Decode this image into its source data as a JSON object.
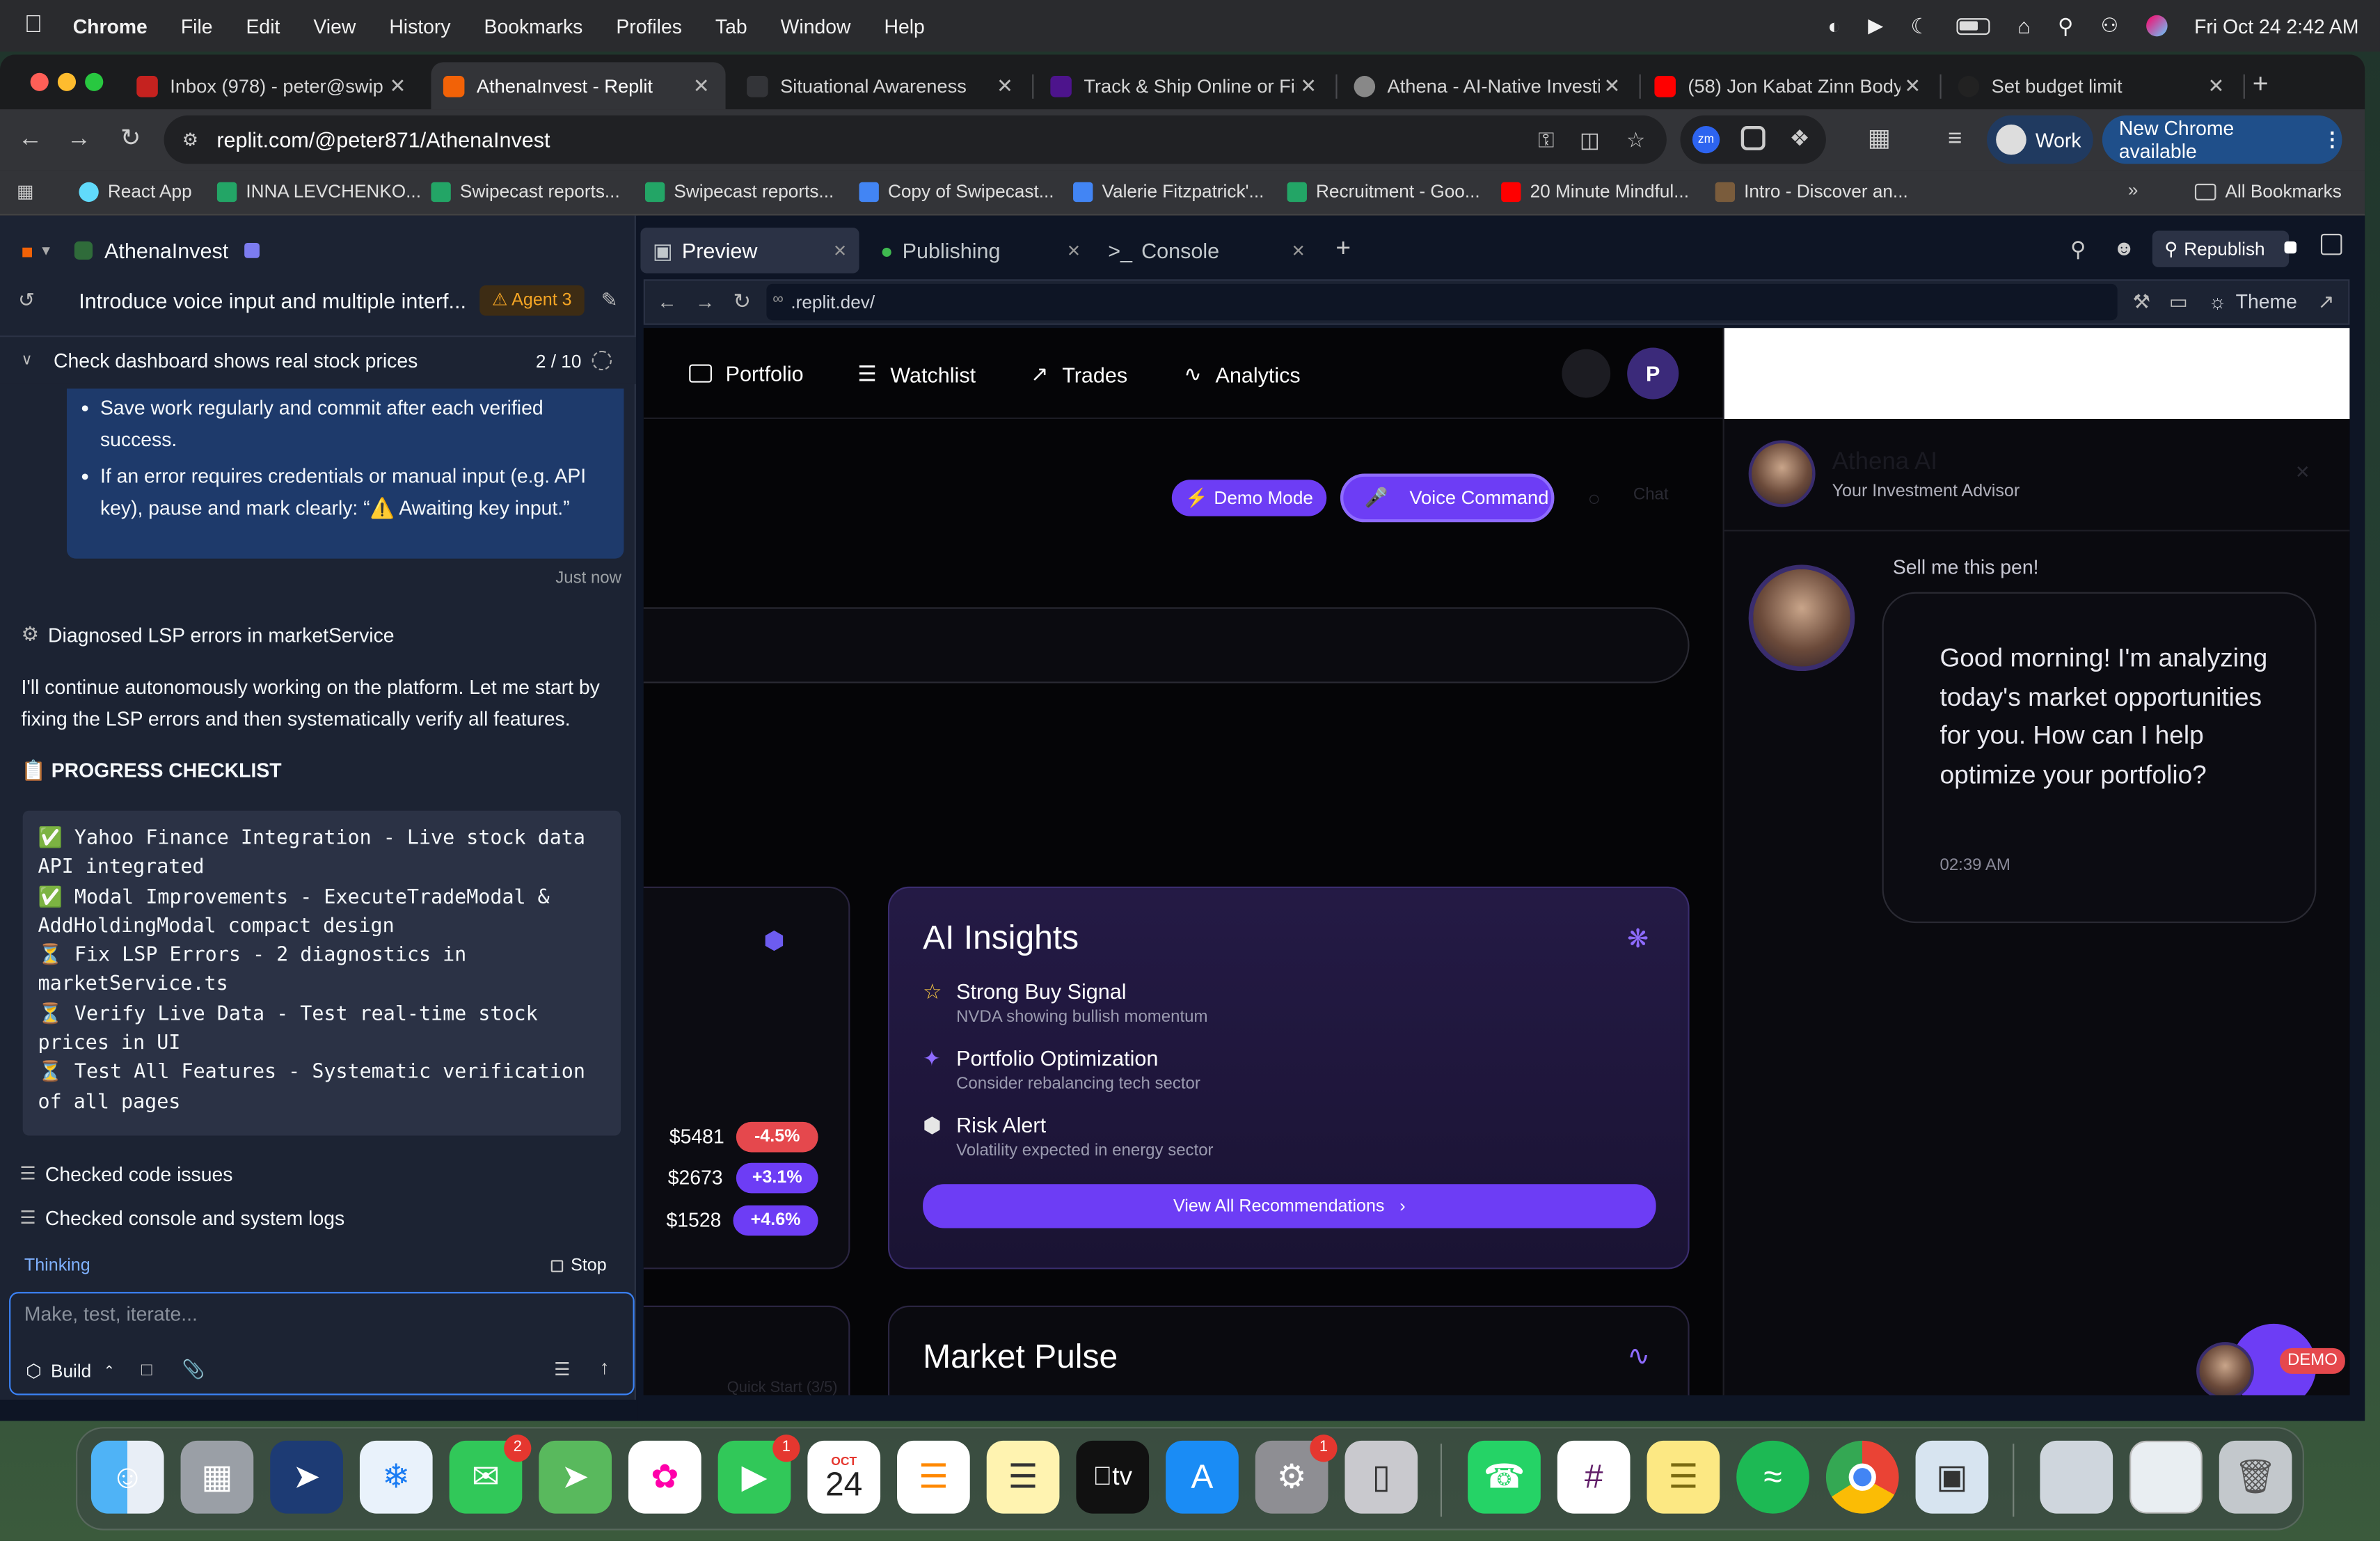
{
  "menubar": {
    "app": "Chrome",
    "items": [
      "File",
      "Edit",
      "View",
      "History",
      "Bookmarks",
      "Profiles",
      "Tab",
      "Window",
      "Help"
    ],
    "clock": "Fri Oct 24  2:42 AM"
  },
  "tabs": [
    {
      "title": "Inbox (978) - peter@swip",
      "color": "#c5221f"
    },
    {
      "title": "AthenaInvest - Replit",
      "color": "#f26207"
    },
    {
      "title": "Situational Awareness",
      "color": "#333438"
    },
    {
      "title": "Track & Ship Online or Fin",
      "color": "#4d148c"
    },
    {
      "title": "Athena - AI-Native Investi",
      "color": "#888888"
    },
    {
      "title": "(58) Jon Kabat Zinn Body",
      "color": "#ff0000"
    },
    {
      "title": "Set budget limit",
      "color": "#222222"
    }
  ],
  "toolbar": {
    "url": "replit.com/@peter871/AthenaInvest",
    "profile": "Work",
    "update": "New Chrome available"
  },
  "bookmarks": [
    {
      "label": "React App",
      "color": "#61dafb"
    },
    {
      "label": "INNA LEVCHENKO...",
      "color": "#23a566"
    },
    {
      "label": "Swipecast reports...",
      "color": "#23a566"
    },
    {
      "label": "Swipecast reports...",
      "color": "#23a566"
    },
    {
      "label": "Copy of Swipecast...",
      "color": "#4285f4"
    },
    {
      "label": "Valerie Fitzpatrick'...",
      "color": "#4285f4"
    },
    {
      "label": "Recruitment - Goo...",
      "color": "#23a566"
    },
    {
      "label": "20 Minute Mindful...",
      "color": "#ff0000"
    },
    {
      "label": "Intro - Discover an...",
      "color": "#7a5c3c"
    }
  ],
  "bookmarks_all": "All Bookmarks",
  "replit": {
    "project": "AthenaInvest",
    "thread_title": "Introduce voice input and multiple interf...",
    "agent_badge": "Agent 3",
    "check_title": "Check dashboard shows real stock prices",
    "check_progress": "2 / 10",
    "bubble_items": [
      "Save work regularly and commit after each verified success.",
      "If an error requires credentials or manual input (e.g. API key), pause and mark clearly: “⚠️ Awaiting key input.”"
    ],
    "bubble_time": "Just now",
    "diagnosed": "Diagnosed LSP errors in marketService",
    "message": "I'll continue autonomously working on the platform. Let me start by fixing the LSP errors and then systematically verify all features.",
    "checklist_title": "📋 PROGRESS CHECKLIST",
    "checklist_code": "✅ Yahoo Finance Integration - Live stock data API integrated\n✅ Modal Improvements - ExecuteTradeModal & AddHoldingModal compact design\n⏳ Fix LSP Errors - 2 diagnostics in marketService.ts\n⏳ Verify Live Data - Test real-time stock prices in UI\n⏳ Test All Features - Systematic verification of all pages",
    "step1": "Checked code issues",
    "step2": "Checked console and system logs",
    "thinking": "Thinking",
    "stop": "Stop",
    "input_placeholder": "Make, test, iterate...",
    "build": "Build"
  },
  "preview": {
    "tabs": [
      "Preview",
      "Publishing",
      "Console"
    ],
    "republish": "Republish",
    "url": ".replit.dev/",
    "theme": "Theme"
  },
  "athena": {
    "nav": [
      "Portfolio",
      "Watchlist",
      "Trades",
      "Analytics"
    ],
    "avatar_initial": "P",
    "demo_mode": "Demo Mode",
    "voice_command": "Voice Command",
    "chat": "Chat",
    "prices": [
      {
        "price": "$5481",
        "change": "-4.5%",
        "color": "#e5484d"
      },
      {
        "price": "$2673",
        "change": "+3.1%",
        "color": "#6d3df5"
      },
      {
        "price": "$1528",
        "change": "+4.6%",
        "color": "#6d3df5"
      }
    ],
    "insights_title": "AI Insights",
    "insights": [
      {
        "title": "Strong Buy Signal",
        "sub": "NVDA showing bullish momentum",
        "icon": "star-icon"
      },
      {
        "title": "Portfolio Optimization",
        "sub": "Consider rebalancing tech sector",
        "icon": "sparkle-icon"
      },
      {
        "title": "Risk Alert",
        "sub": "Volatility expected in energy sector",
        "icon": "shield-icon"
      }
    ],
    "view_all": "View All Recommendations",
    "market_pulse": "Market Pulse",
    "quick_start": "Quick Start (3/5)",
    "advisor_name": "Athena AI",
    "advisor_role": "Your Investment Advisor",
    "user_message": "Sell me this pen!",
    "ai_message": "Good morning! I'm analyzing today's market opportunities for you. How can I help optimize your portfolio?",
    "ai_time": "02:39 AM",
    "demo_badge": "DEMO"
  },
  "dock": {
    "messages_badge": "2",
    "facetime_badge": "1",
    "settings_badge": "1",
    "calendar_month": "OCT",
    "calendar_day": "24",
    "tv_label": "tv"
  }
}
